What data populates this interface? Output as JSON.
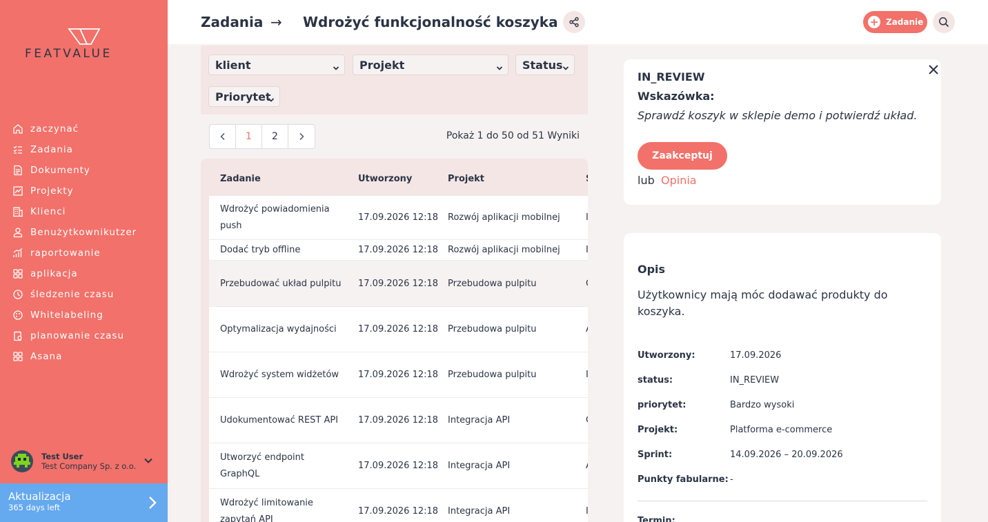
{
  "brand": {
    "name": "FEATVALUE"
  },
  "sidebar": {
    "items": [
      {
        "label": "zaczynać",
        "icon": "home-icon"
      },
      {
        "label": "Zadania",
        "icon": "tasks-icon"
      },
      {
        "label": "Dokumenty",
        "icon": "documents-icon"
      },
      {
        "label": "Projekty",
        "icon": "projects-icon"
      },
      {
        "label": "Klienci",
        "icon": "clients-icon"
      },
      {
        "label": "Benużytkownikutzer",
        "icon": "user-icon"
      },
      {
        "label": "raportowanie",
        "icon": "reporting-icon"
      },
      {
        "label": "aplikacja",
        "icon": "apps-icon"
      },
      {
        "label": "śledzenie czasu",
        "icon": "time-tracking-icon"
      },
      {
        "label": "Whitelabeling",
        "icon": "whitelabel-icon"
      },
      {
        "label": "planowanie czasu",
        "icon": "time-planning-icon"
      },
      {
        "label": "Asana",
        "icon": "asana-icon"
      }
    ],
    "user": {
      "name": "Test User",
      "company": "Test Company Sp. z o.o."
    },
    "upgrade": {
      "title": "Aktualizacja",
      "subtitle": "365 days left"
    }
  },
  "header": {
    "breadcrumb_root": "Zadania",
    "breadcrumb_arrow": "→",
    "title": "Wdrożyć funkcjonalność koszyka",
    "new_task_label": "Zadanie"
  },
  "filters": {
    "client": "klient",
    "project": "Projekt",
    "status": "Status",
    "priority": "Priorytet"
  },
  "pagination": {
    "prev": "‹",
    "next": "›",
    "pages": [
      "1",
      "2"
    ],
    "current": "1",
    "results_text": "Pokaż 1 do 50 od 51 Wyniki"
  },
  "table": {
    "columns": [
      "Zadanie",
      "Utworzony",
      "Projekt",
      "S"
    ],
    "rows": [
      {
        "task": "Wdrożyć powiadomienia push",
        "created": "17.09.2026 12:18",
        "project": "Rozwój aplikacji mobilnej",
        "s": "I"
      },
      {
        "task": "Dodać tryb offline",
        "created": "17.09.2026 12:18",
        "project": "Rozwój aplikacji mobilnej",
        "s": "I"
      },
      {
        "task": "Przebudować układ pulpitu",
        "created": "17.09.2026 12:18",
        "project": "Przebudowa pulpitu",
        "s": "C"
      },
      {
        "task": "Optymalizacja wydajności",
        "created": "17.09.2026 12:18",
        "project": "Przebudowa pulpitu",
        "s": "A"
      },
      {
        "task": "Wdrożyć system widżetów",
        "created": "17.09.2026 12:18",
        "project": "Przebudowa pulpitu",
        "s": "I"
      },
      {
        "task": "Udokumentować REST API",
        "created": "17.09.2026 12:18",
        "project": "Integracja API",
        "s": "C"
      },
      {
        "task": "Utworzyć endpoint GraphQL",
        "created": "17.09.2026 12:18",
        "project": "Integracja API",
        "s": "A"
      },
      {
        "task": "Wdrożyć limitowanie zapytań API",
        "created": "17.09.2026 12:18",
        "project": "Integracja API",
        "s": "I"
      }
    ]
  },
  "review": {
    "status": "IN_REVIEW",
    "hint_label": "Wskazówka:",
    "hint_text": "Sprawdź koszyk w sklepie demo i potwierdź układ.",
    "accept_label": "Zaakceptuj",
    "or_label": "lub",
    "opinion_label": "Opinia"
  },
  "details": {
    "title": "Opis",
    "description": "Użytkownicy mają móc dodawać produkty do koszyka.",
    "meta": [
      {
        "key": "Utworzony:",
        "value": "17.09.2026"
      },
      {
        "key": "status:",
        "value": "IN_REVIEW"
      },
      {
        "key": "priorytet:",
        "value": "Bardzo wysoki"
      },
      {
        "key": "Projekt:",
        "value": "Platforma e-commerce"
      },
      {
        "key": "Sprint:",
        "value": "14.09.2026 – 20.09.2026"
      },
      {
        "key": "Punkty fabularne:",
        "value": "-"
      }
    ],
    "deadline_label": "Termin:"
  },
  "colors": {
    "accent": "#f2716a",
    "upgrade": "#65a9ef",
    "text": "#2b3445"
  }
}
